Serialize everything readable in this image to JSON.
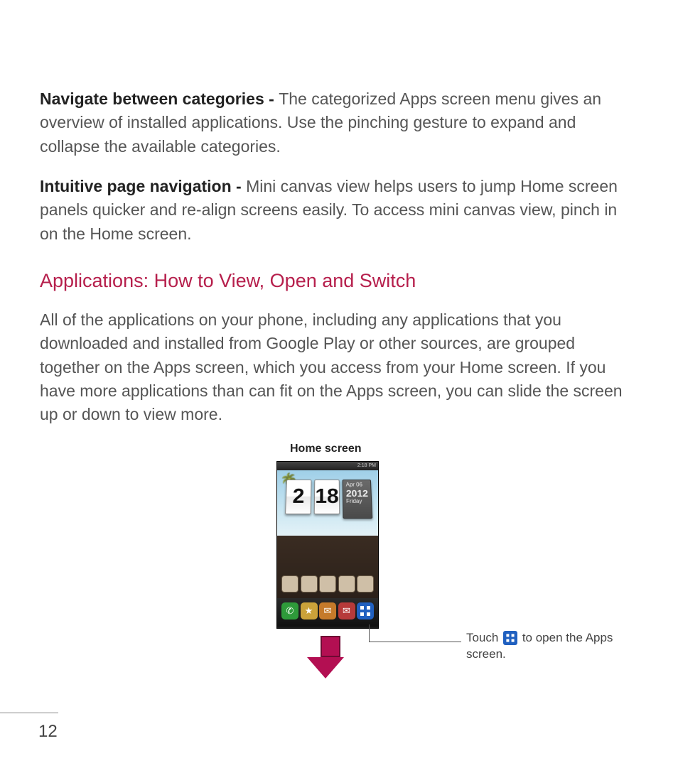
{
  "para1": {
    "lead": "Navigate between categories - ",
    "rest": "The categorized Apps screen menu gives an overview of installed applications. Use the pinching gesture to expand and collapse the available categories."
  },
  "para2": {
    "lead": "Intuitive page navigation - ",
    "rest": "Mini canvas view helps users to jump Home screen panels quicker and re-align screens easily. To access mini canvas view, pinch in on the Home screen."
  },
  "section_heading": "Applications: How to View, Open and Switch",
  "para3": "All of the applications on your phone, including any applications that you downloaded and installed from Google Play or other sources, are grouped together on the Apps screen, which you access from your Home screen. If you have more applications than can fit on the Apps screen, you can slide the screen up or down to view more.",
  "figure": {
    "caption": "Home screen",
    "status_time": "2:18 PM",
    "clock_hour": "2",
    "clock_min": "18",
    "date_small": "Apr 06",
    "date_year": "2012",
    "date_day": "Friday"
  },
  "callout": {
    "before": "Touch ",
    "after": " to open the Apps screen."
  },
  "page_number": "12"
}
